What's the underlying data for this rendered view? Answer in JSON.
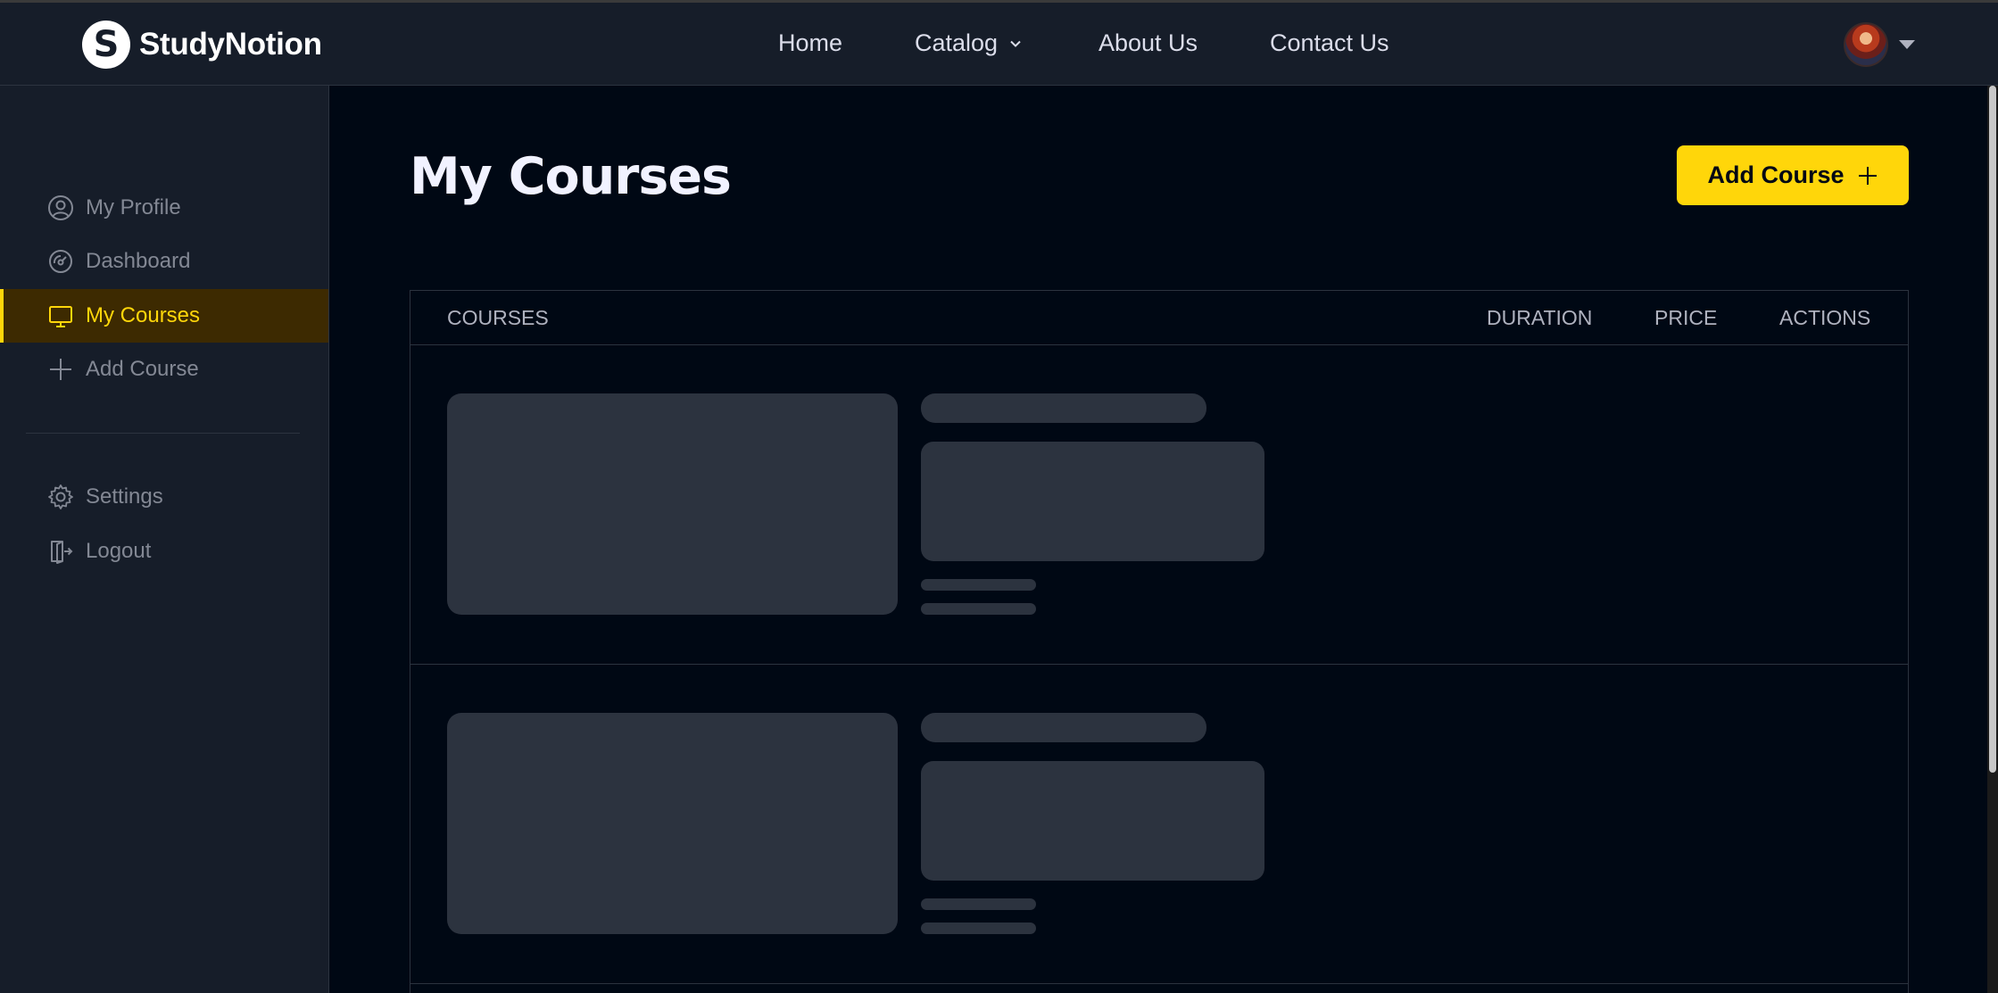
{
  "header": {
    "brand": "StudyNotion",
    "brand_mark": "S",
    "nav": [
      {
        "label": "Home"
      },
      {
        "label": "Catalog",
        "icon": "chevron-down-icon"
      },
      {
        "label": "About Us"
      },
      {
        "label": "Contact Us"
      }
    ],
    "profile": {
      "icon": "avatar",
      "menu_icon": "caret-down-icon"
    }
  },
  "sidebar": {
    "items": [
      {
        "label": "My Profile",
        "icon": "user-circle-icon",
        "active": false
      },
      {
        "label": "Dashboard",
        "icon": "gauge-icon",
        "active": false
      },
      {
        "label": "My Courses",
        "icon": "monitor-icon",
        "active": true
      },
      {
        "label": "Add Course",
        "icon": "plus-icon",
        "active": false
      }
    ],
    "bottom_items": [
      {
        "label": "Settings",
        "icon": "gear-icon"
      },
      {
        "label": "Logout",
        "icon": "logout-icon"
      }
    ]
  },
  "main": {
    "title": "My Courses",
    "add_button": {
      "label": "Add Course",
      "icon": "plus-icon"
    },
    "table": {
      "columns": [
        "COURSES",
        "DURATION",
        "PRICE",
        "ACTIONS"
      ],
      "loading_rows": 2
    }
  },
  "colors": {
    "accent": "#FFD60A",
    "active_bg": "#3D2A01",
    "page_bg": "#000814",
    "panel_bg": "#161D29",
    "skeleton": "#2C333F"
  }
}
